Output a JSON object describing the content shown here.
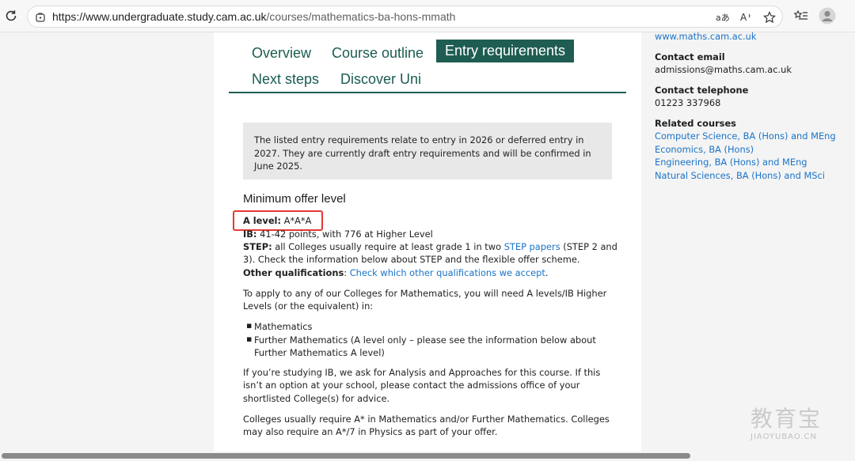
{
  "browser": {
    "url_host": "https://www.undergraduate.study.cam.ac.uk",
    "url_path": "/courses/mathematics-ba-hons-mmath",
    "icons": [
      "refresh-icon",
      "site-info-icon",
      "translate-icon",
      "read-aloud-icon",
      "favorite-star-icon",
      "favorites-list-icon",
      "profile-avatar"
    ]
  },
  "tabs": {
    "overview": "Overview",
    "course_outline": "Course outline",
    "entry_requirements": "Entry requirements",
    "next_steps": "Next steps",
    "discover_uni": "Discover Uni",
    "active": "Entry requirements"
  },
  "notice": {
    "line1": "The listed entry requirements relate to entry in 2026 or deferred entry in",
    "line2": "2027. They are currently draft entry requirements and will be confirmed in",
    "line3": "June 2025."
  },
  "offer": {
    "heading": "Minimum offer level",
    "a_level_label": "A level:",
    "a_level_value": " A*A*A",
    "ib_label": "IB:",
    "ib_value": " 41-42 points, with 776 at Higher Level",
    "step_label": "STEP:",
    "step_text_1": " all Colleges usually require at least grade 1 in two ",
    "step_link": "STEP papers",
    "step_text_2": " (STEP 2 and",
    "step_line2": "3). Check the information below about STEP and the flexible offer scheme.",
    "other_label": "Other qualifications",
    "other_sep": ": ",
    "other_link": "Check which other qualifications we accept",
    "other_end": "."
  },
  "body": {
    "apply_line1": "To apply to any of our Colleges for Mathematics, you will need A levels/IB Higher",
    "apply_line2": "Levels (or the equivalent) in:",
    "bullet1": "Mathematics",
    "bullet2_line1": "Further Mathematics (A level only – please see the information below about",
    "bullet2_line2": "Further Mathematics A level)",
    "ib_line1": "If you’re studying IB, we ask for Analysis and Approaches for this course. If this",
    "ib_line2": "isn’t an option at your school, please contact the admissions office of your",
    "ib_line3": "shortlisted College(s) for advice.",
    "colleges_line1": "Colleges usually require A* in Mathematics and/or Further Mathematics. Colleges",
    "colleges_line2": "may also require an A*/7 in Physics as part of your offer."
  },
  "sidebar": {
    "website_link": "www.maths.cam.ac.uk",
    "email_heading": "Contact email",
    "email_value": "admissions@maths.cam.ac.uk",
    "phone_heading": "Contact telephone",
    "phone_value": "01223 337968",
    "related_heading": "Related courses",
    "related": [
      "Computer Science, BA (Hons) and MEng",
      "Economics, BA (Hons)",
      "Engineering, BA (Hons) and MEng",
      "Natural Sciences, BA (Hons) and MSci"
    ]
  },
  "watermark": {
    "cn": "教育宝",
    "en": "JIAOYUBAO.CN"
  },
  "colors": {
    "accent_green": "#1f5d52",
    "link_blue": "#1a73c8",
    "highlight_red": "#e53935"
  }
}
